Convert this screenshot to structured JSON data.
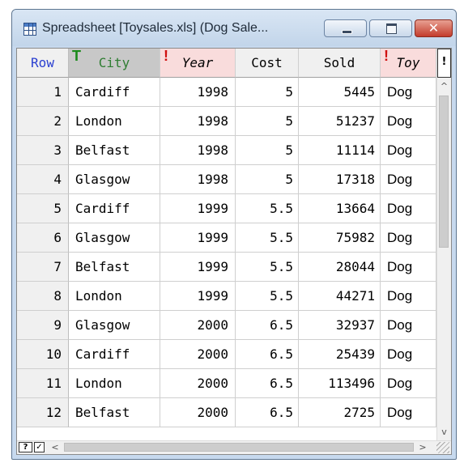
{
  "window": {
    "title": "Spreadsheet [Toysales.xls] (Dog Sale...",
    "icons": {
      "app": "spreadsheet-grid-icon",
      "minimize": "minimize-icon",
      "maximize": "maximize-icon",
      "close": "close-icon"
    },
    "close_glyph": "✕"
  },
  "grid": {
    "corner_label": "Row",
    "header_markers": {
      "city": "T",
      "year": "!",
      "toy": "!"
    },
    "columns": [
      "City",
      "Year",
      "Cost",
      "Sold",
      "Toy"
    ],
    "rows": [
      {
        "row": "1",
        "city": "Cardiff",
        "year": "1998",
        "cost": "5",
        "sold": "5445",
        "toy": "Dog"
      },
      {
        "row": "2",
        "city": "London",
        "year": "1998",
        "cost": "5",
        "sold": "51237",
        "toy": "Dog"
      },
      {
        "row": "3",
        "city": "Belfast",
        "year": "1998",
        "cost": "5",
        "sold": "11114",
        "toy": "Dog"
      },
      {
        "row": "4",
        "city": "Glasgow",
        "year": "1998",
        "cost": "5",
        "sold": "17318",
        "toy": "Dog"
      },
      {
        "row": "5",
        "city": "Cardiff",
        "year": "1999",
        "cost": "5.5",
        "sold": "13664",
        "toy": "Dog"
      },
      {
        "row": "6",
        "city": "Glasgow",
        "year": "1999",
        "cost": "5.5",
        "sold": "75982",
        "toy": "Dog"
      },
      {
        "row": "7",
        "city": "Belfast",
        "year": "1999",
        "cost": "5.5",
        "sold": "28044",
        "toy": "Dog"
      },
      {
        "row": "8",
        "city": "London",
        "year": "1999",
        "cost": "5.5",
        "sold": "44271",
        "toy": "Dog"
      },
      {
        "row": "9",
        "city": "Glasgow",
        "year": "2000",
        "cost": "6.5",
        "sold": "32937",
        "toy": "Dog"
      },
      {
        "row": "10",
        "city": "Cardiff",
        "year": "2000",
        "cost": "6.5",
        "sold": "25439",
        "toy": "Dog"
      },
      {
        "row": "11",
        "city": "London",
        "year": "2000",
        "cost": "6.5",
        "sold": "113496",
        "toy": "Dog"
      },
      {
        "row": "12",
        "city": "Belfast",
        "year": "2000",
        "cost": "6.5",
        "sold": "2725",
        "toy": "Dog"
      }
    ]
  },
  "scrollbars": {
    "vertical_corner": "!",
    "up_arrow": "^",
    "down_arrow": "v",
    "left_arrow": "<",
    "right_arrow": ">"
  },
  "footer": {
    "help_label": "?",
    "check_label": "✓"
  },
  "colors": {
    "accent_row_header": "#2a3fd0",
    "text_marker": "#1a8a1a",
    "error_marker": "#d01010",
    "warn_header_bg": "#f9dcdc"
  }
}
